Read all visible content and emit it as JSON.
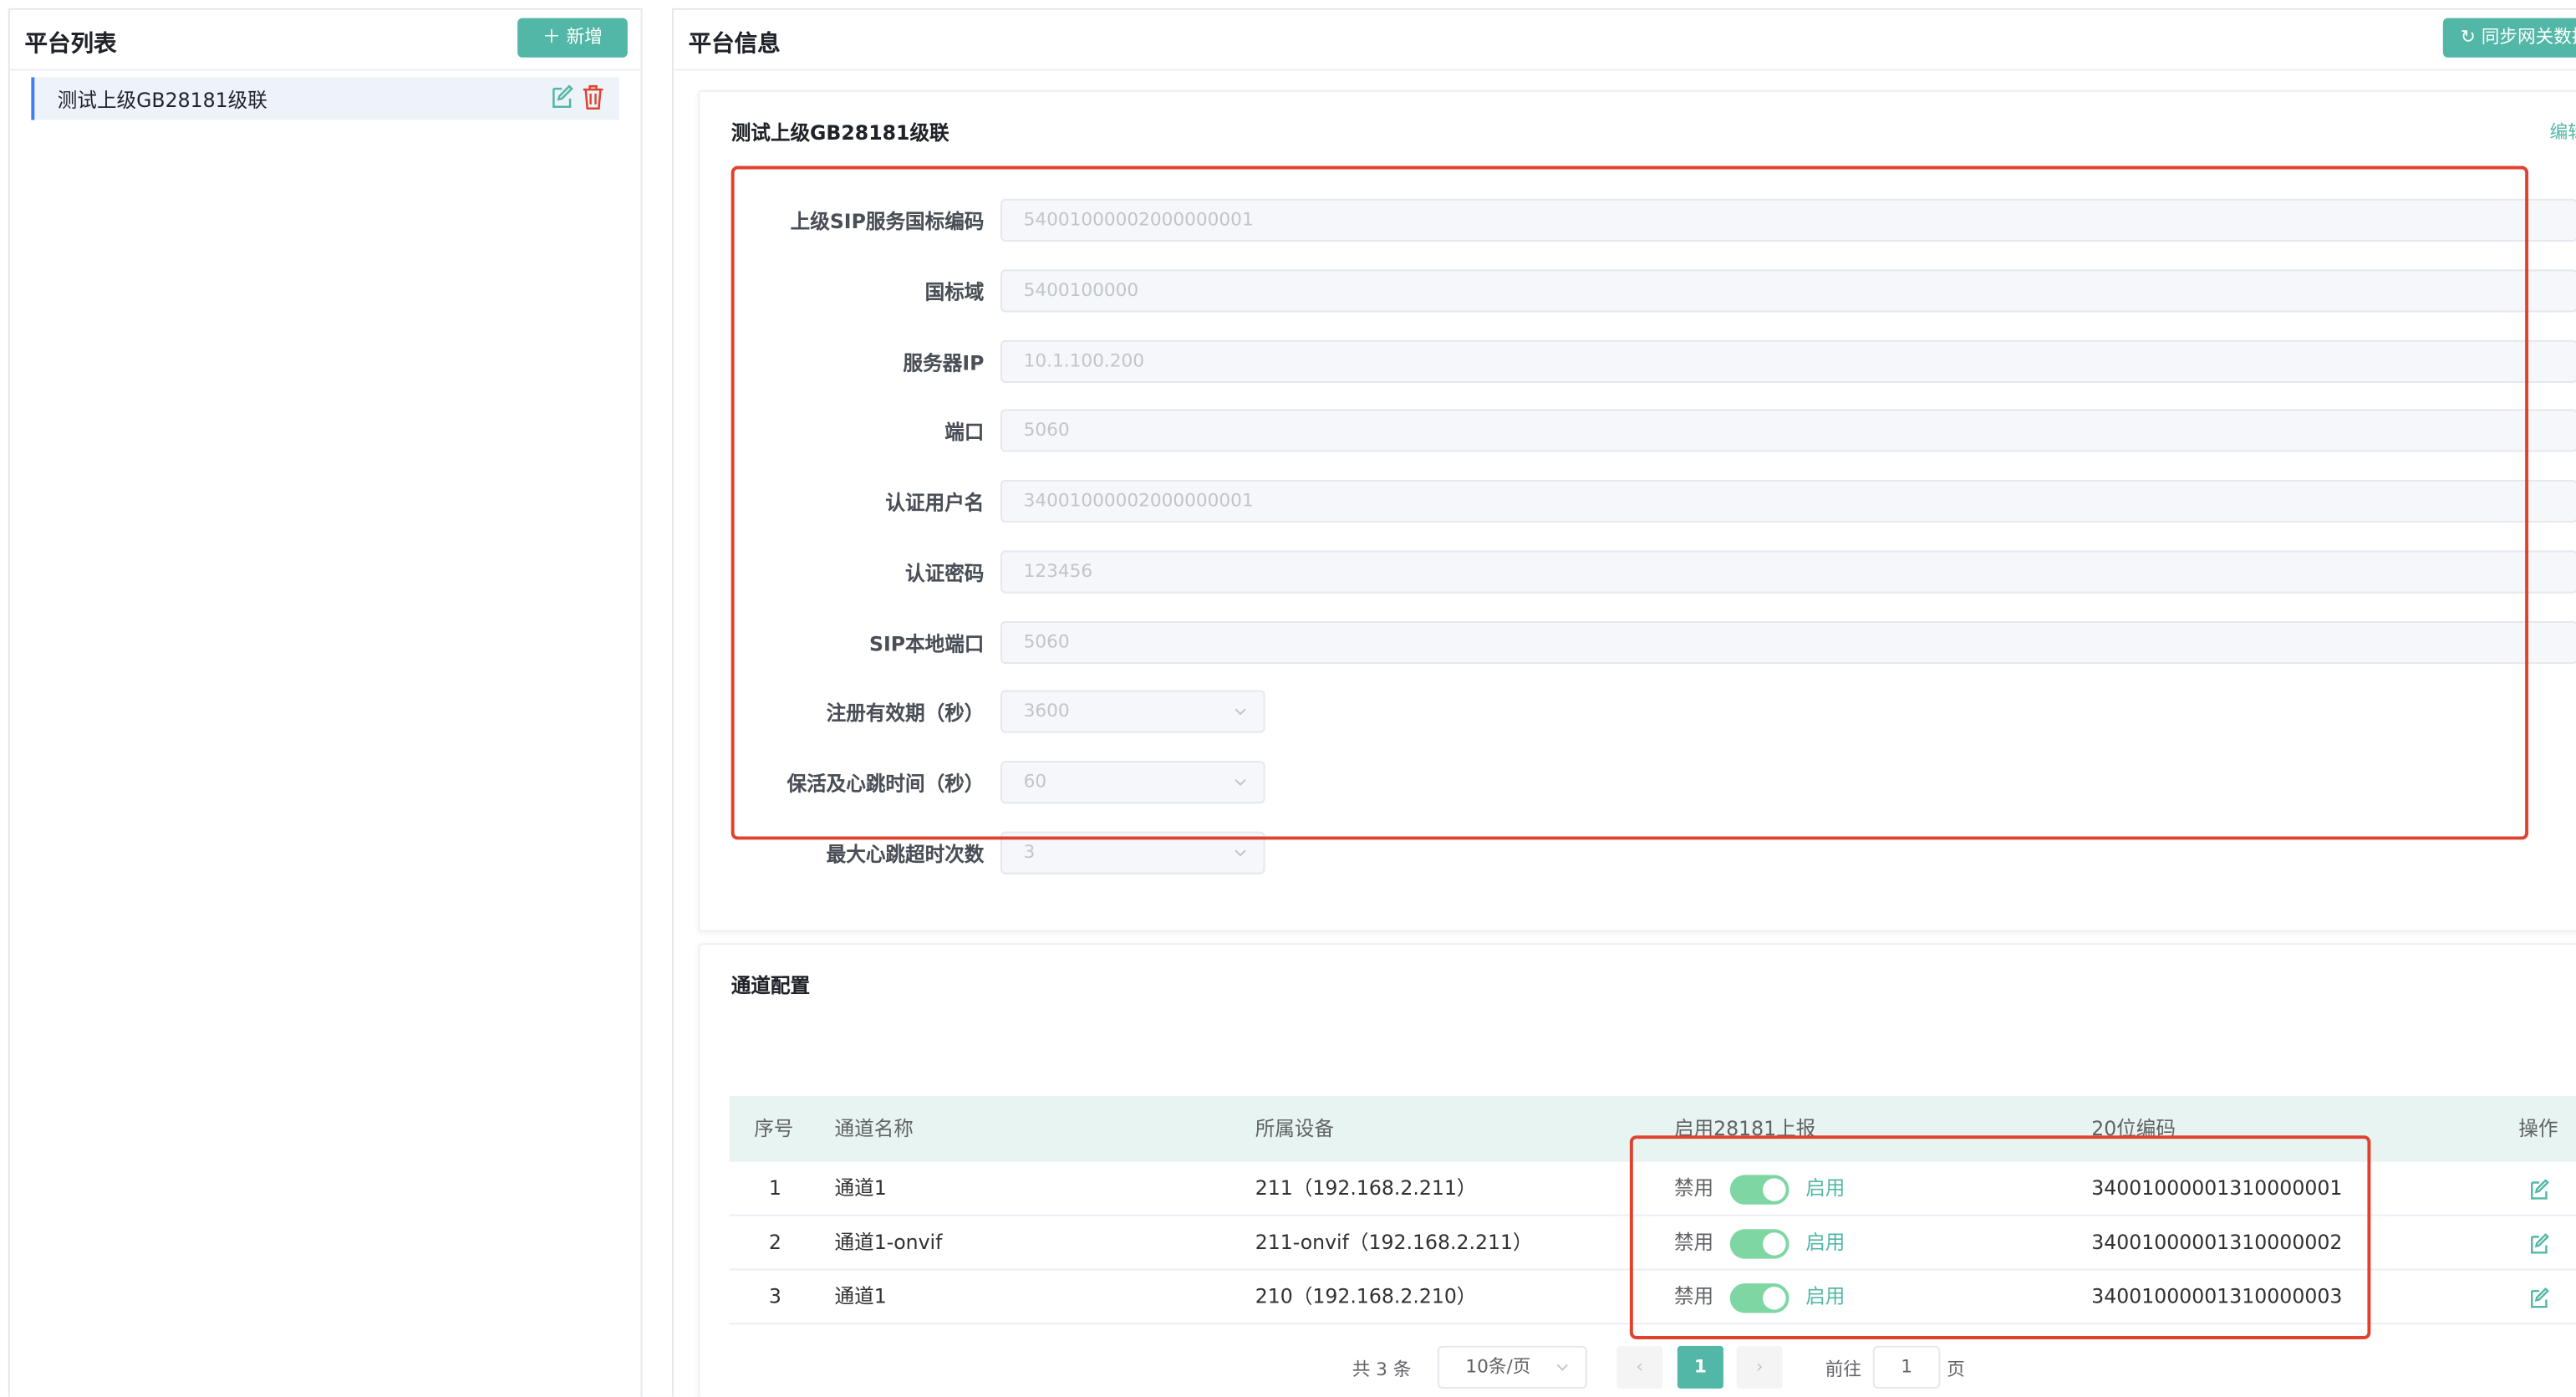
{
  "left": {
    "title": "平台列表",
    "add_button": "＋ 新增",
    "platforms": [
      {
        "name": "测试上级GB28181级联"
      }
    ]
  },
  "right": {
    "title": "平台信息",
    "sync_button": "↻ 同步网关数据"
  },
  "info_card": {
    "title": "测试上级GB28181级联",
    "edit_link": "编辑",
    "fields": [
      {
        "label": "上级SIP服务国标编码",
        "value": "54001000002000000001"
      },
      {
        "label": "国标域",
        "value": "5400100000"
      },
      {
        "label": "服务器IP",
        "value": "10.1.100.200"
      },
      {
        "label": "端口",
        "value": "5060"
      },
      {
        "label": "认证用户名",
        "value": "34001000002000000001"
      },
      {
        "label": "认证密码",
        "value": "123456"
      },
      {
        "label": "SIP本地端口",
        "value": "5060"
      },
      {
        "label": "注册有效期（秒）",
        "value": "3600"
      },
      {
        "label": "保活及心跳时间（秒）",
        "value": "60"
      },
      {
        "label": "最大心跳超时次数",
        "value": "3"
      }
    ]
  },
  "channel_card": {
    "title": "通道配置",
    "columns": [
      "序号",
      "通道名称",
      "所属设备",
      "启用28181上报",
      "20位编码",
      "操作"
    ],
    "switch_off_label": "禁用",
    "switch_on_label": "启用",
    "rows": [
      {
        "idx": "1",
        "name": "通道1",
        "device": "211（192.168.2.211）",
        "enabled": true,
        "code": "34001000001310000001"
      },
      {
        "idx": "2",
        "name": "通道1-onvif",
        "device": "211-onvif（192.168.2.211）",
        "enabled": true,
        "code": "34001000001310000002"
      },
      {
        "idx": "3",
        "name": "通道1",
        "device": "210（192.168.2.210）",
        "enabled": true,
        "code": "34001000001310000003"
      }
    ],
    "pagination": {
      "total": "共 3 条",
      "page_size": "10条/页",
      "prev": "‹",
      "current": "1",
      "next": "›",
      "goto_label": "前往",
      "goto_value": "1",
      "page_label": "页"
    }
  },
  "colors": {
    "primary": "#52b7a6",
    "highlight_box": "#e1412f",
    "toggle_on": "#7ed6a3",
    "selected_border": "#3e7df2"
  }
}
